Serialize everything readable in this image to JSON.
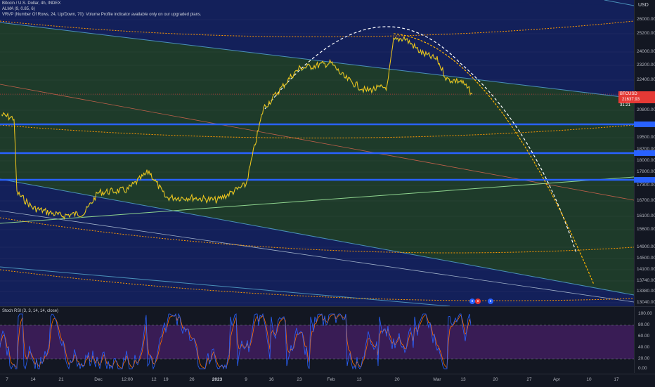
{
  "chart": {
    "symbol_line": "Bitcoin / U.S. Dollar, 4h, INDEX",
    "alma_line": "ALMA (9, 0.85, 6)",
    "vrvp_line": "VRVP (Number Of Rows, 24, Up/Down, 70): Volume Profile indicator available only on our upgraded plans.",
    "osc_line": "Stoch RSI (3, 3, 14, 14, close)",
    "currency": "USD",
    "last_price_symbol": "BTCUSD",
    "last_price": "21637.93",
    "countdown": "31:21"
  },
  "price_axis": [
    "26000.00",
    "25200.00",
    "24000.00",
    "23200.00",
    "22400.00",
    "21600.00",
    "20800.00",
    "20000.00",
    "19500.00",
    "18700.00",
    "18000.00",
    "17800.00",
    "17300.00",
    "16700.00",
    "16100.00",
    "15600.00",
    "14900.00",
    "14500.00",
    "14100.00",
    "13740.00",
    "13380.00",
    "13040.00"
  ],
  "osc_axis": [
    "100.00",
    "80.00",
    "60.00",
    "40.00",
    "20.00",
    "0.00"
  ],
  "time_axis": [
    {
      "label": "7",
      "bold": false
    },
    {
      "label": "14",
      "bold": false
    },
    {
      "label": "21",
      "bold": false
    },
    {
      "label": "Dec",
      "bold": false
    },
    {
      "label": "12:00",
      "bold": false
    },
    {
      "label": "12",
      "bold": false
    },
    {
      "label": "19",
      "bold": false
    },
    {
      "label": "26",
      "bold": false
    },
    {
      "label": "2023",
      "bold": true
    },
    {
      "label": "9",
      "bold": false
    },
    {
      "label": "16",
      "bold": false
    },
    {
      "label": "23",
      "bold": false
    },
    {
      "label": "Feb",
      "bold": false
    },
    {
      "label": "13",
      "bold": false
    },
    {
      "label": "20",
      "bold": false
    },
    {
      "label": "Mar",
      "bold": false
    },
    {
      "label": "13",
      "bold": false
    },
    {
      "label": "20",
      "bold": false
    },
    {
      "label": "27",
      "bold": false
    },
    {
      "label": "Apr",
      "bold": false
    },
    {
      "label": "10",
      "bold": false
    },
    {
      "label": "17",
      "bold": false
    }
  ],
  "colors": {
    "price_line": "#f5c518",
    "support_line": "#2962ff",
    "channel_fill": "#1e3b2a",
    "outer_fill": "#13205a",
    "stoch_band": "#4a1f6b",
    "stoch_k": "#2962ff",
    "stoch_d": "#ff6d00"
  },
  "chart_data": {
    "type": "line",
    "series": [
      {
        "name": "Bitcoin / U.S. Dollar",
        "x": [
          "Nov 1",
          "Nov 7",
          "Nov 9",
          "Nov 14",
          "Nov 21",
          "Nov 28",
          "Dec 5",
          "Dec 12",
          "Dec 15",
          "Dec 19",
          "Dec 26",
          "Jan 2",
          "Jan 9",
          "Jan 12",
          "Jan 14",
          "Jan 16",
          "Jan 21",
          "Jan 23",
          "Jan 30",
          "Feb 2",
          "Feb 9",
          "Feb 13",
          "Feb 16",
          "Feb 20",
          "Feb 24",
          "Mar 1",
          "Mar 3",
          "Mar 7",
          "Mar 9"
        ],
        "values": [
          20500,
          20300,
          17000,
          16400,
          16100,
          16200,
          17000,
          17100,
          17800,
          16800,
          16800,
          16700,
          17300,
          18800,
          20900,
          21300,
          22600,
          23000,
          23300,
          22500,
          21800,
          22000,
          24700,
          24900,
          23900,
          23500,
          22400,
          22300,
          21637
        ]
      }
    ],
    "ylim": [
      13040,
      26300
    ],
    "horizontal_levels": [
      20260,
      19160,
      17700
    ]
  }
}
